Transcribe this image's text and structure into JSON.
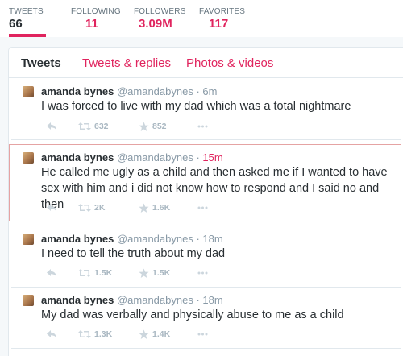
{
  "profile_stats": [
    {
      "label": "TWEETS",
      "value": "66"
    },
    {
      "label": "FOLLOWING",
      "value": "11"
    },
    {
      "label": "FOLLOWERS",
      "value": "3.09M"
    },
    {
      "label": "FAVORITES",
      "value": "117"
    }
  ],
  "colors": {
    "accent": "#e0245e",
    "text": "#292f33",
    "muted": "#8899a6",
    "icon": "#aab8c2"
  },
  "tabs": [
    {
      "label": "Tweets"
    },
    {
      "label": "Tweets & replies"
    },
    {
      "label": "Photos & videos"
    }
  ],
  "tweets": [
    {
      "name": "amanda bynes",
      "handle": "@amandabynes",
      "time": "6m",
      "text": "I was forced to live with my dad which was a total nightmare",
      "retweets": "632",
      "favorites": "852"
    },
    {
      "name": "amanda bynes",
      "handle": "@amandabynes",
      "time": "15m",
      "text": "He called me ugly as a child and then asked me if I wanted to have sex with him and i did not know how to respond and I said no and then",
      "retweets": "2K",
      "favorites": "1.6K"
    },
    {
      "name": "amanda bynes",
      "handle": "@amandabynes",
      "time": "18m",
      "text": "I need to tell the truth about my dad",
      "retweets": "1.5K",
      "favorites": "1.5K"
    },
    {
      "name": "amanda bynes",
      "handle": "@amandabynes",
      "time": "18m",
      "text": "My dad was verbally and physically abuse to me as a child",
      "retweets": "1.3K",
      "favorites": "1.4K"
    }
  ],
  "icons": {
    "reply": "reply-icon",
    "retweet": "retweet-icon",
    "favorite": "star-icon",
    "more": "more-icon"
  }
}
